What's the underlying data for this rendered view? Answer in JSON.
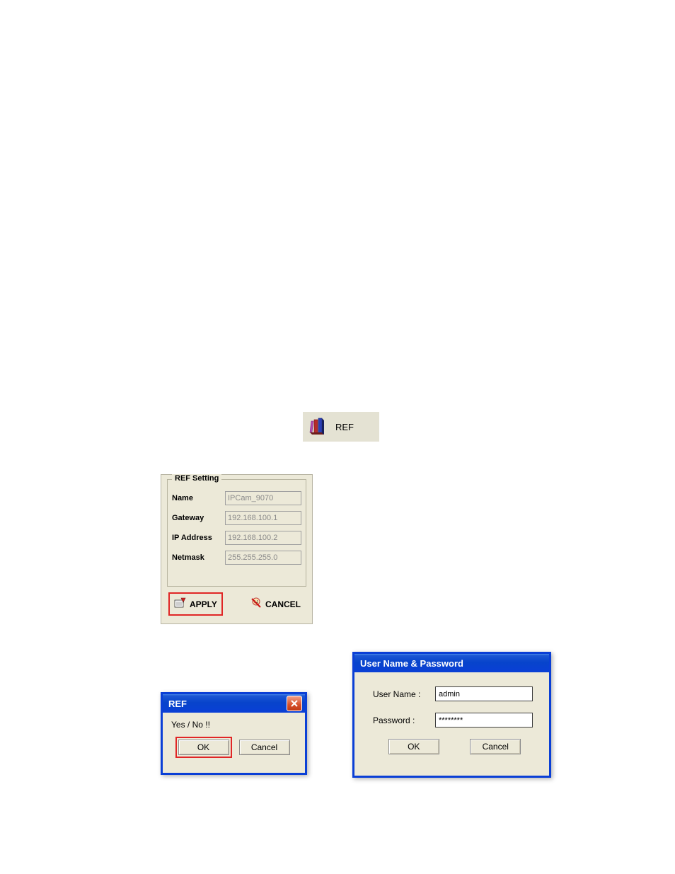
{
  "toolbar": {
    "ref_label": "REF"
  },
  "ref_setting": {
    "title": "REF Setting",
    "fields": {
      "name_label": "Name",
      "name_value": "IPCam_9070",
      "gateway_label": "Gateway",
      "gateway_value": "192.168.100.1",
      "ip_label": "IP Address",
      "ip_value": "192.168.100.2",
      "netmask_label": "Netmask",
      "netmask_value": "255.255.255.0"
    },
    "apply_label": "APPLY",
    "cancel_label": "CANCEL"
  },
  "confirm_dialog": {
    "title": "REF",
    "message": "Yes / No !!",
    "ok_label": "OK",
    "cancel_label": "Cancel"
  },
  "auth_dialog": {
    "title": "User Name & Password",
    "username_label": "User Name :",
    "username_value": "admin",
    "password_label": "Password :",
    "password_value": "********",
    "ok_label": "OK",
    "cancel_label": "Cancel"
  }
}
